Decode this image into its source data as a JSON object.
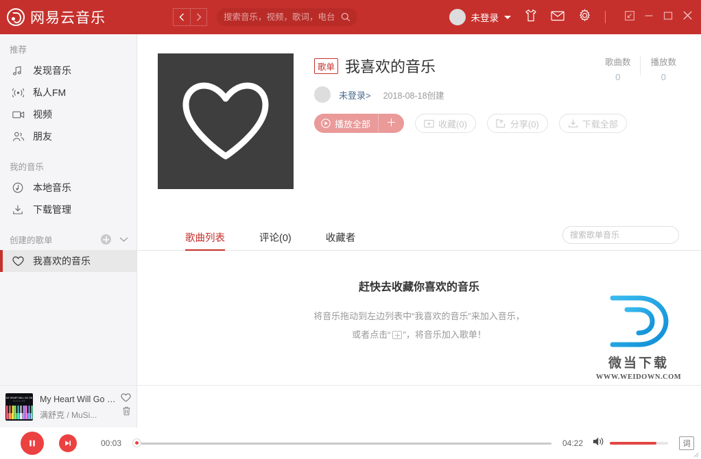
{
  "app": {
    "brand": "网易云音乐",
    "brand_logo_icon": "netease-cloud-music-logo"
  },
  "topbar": {
    "nav_back_icon": "chevron-left-icon",
    "nav_forward_icon": "chevron-right-icon",
    "search": {
      "placeholder": "搜索音乐，视频，歌词，电台",
      "value": "",
      "icon": "search-icon"
    },
    "user": {
      "name": "未登录",
      "avatar_icon": "avatar-placeholder",
      "caret_icon": "chevron-down-icon"
    },
    "icons": {
      "shirt": "shirt-icon",
      "mail": "mail-icon",
      "settings": "gear-icon",
      "mini": "mini-mode-icon",
      "minimize": "minimize-icon",
      "maximize": "maximize-icon",
      "close": "close-icon"
    }
  },
  "sidebar": {
    "sections": [
      {
        "title": "推荐",
        "items": [
          {
            "label": "发现音乐",
            "icon": "music-note-icon",
            "active": false
          },
          {
            "label": "私人FM",
            "icon": "radio-icon",
            "active": false
          },
          {
            "label": "视频",
            "icon": "video-camera-icon",
            "active": false
          },
          {
            "label": "朋友",
            "icon": "friends-icon",
            "active": false
          }
        ]
      },
      {
        "title": "我的音乐",
        "items": [
          {
            "label": "本地音乐",
            "icon": "clock-music-icon",
            "active": false
          },
          {
            "label": "下载管理",
            "icon": "download-icon",
            "active": false
          }
        ]
      },
      {
        "title": "创建的歌单",
        "add_icon": "plus-circle-icon",
        "collapse_icon": "chevron-down-icon",
        "items": [
          {
            "label": "我喜欢的音乐",
            "icon": "heart-outline-icon",
            "active": true
          }
        ]
      }
    ]
  },
  "playlist": {
    "cover_icon": "heart-outline-large-icon",
    "tag": "歌单",
    "title": "我喜欢的音乐",
    "author": "未登录>",
    "author_avatar_icon": "avatar-placeholder",
    "created": "2018-08-18创建",
    "buttons": {
      "play_all": {
        "label": "播放全部",
        "icon": "play-circle-icon"
      },
      "add": {
        "label": "＋",
        "icon": "plus-icon"
      },
      "collect": {
        "label": "收藏(0)",
        "icon": "folder-plus-icon"
      },
      "share": {
        "label": "分享(0)",
        "icon": "share-icon"
      },
      "download": {
        "label": "下载全部",
        "icon": "download-icon"
      }
    },
    "stats": [
      {
        "label": "歌曲数",
        "value": "0"
      },
      {
        "label": "播放数",
        "value": "0"
      }
    ]
  },
  "tabs": {
    "items": [
      {
        "label": "歌曲列表",
        "active": true
      },
      {
        "label": "评论(0)",
        "active": false
      },
      {
        "label": "收藏者",
        "active": false
      }
    ],
    "search": {
      "placeholder": "搜索歌单音乐",
      "value": "",
      "icon": "search-icon"
    }
  },
  "empty_state": {
    "title": "赶快去收藏你喜欢的音乐",
    "line1_before": "将音乐拖动到左边列表中“",
    "line1_highlight": "我喜欢的音乐",
    "line1_after": "”来加入音乐，",
    "line2_before": "或者点击“",
    "line2_icon": "add-to-playlist-icon",
    "line2_after": "”，将音乐加入歌单！"
  },
  "watermark": {
    "logo_icon": "weidown-d-logo",
    "text": "微当下载",
    "url": "WWW.WEIDOWN.COM"
  },
  "now_playing": {
    "album_art_icon": "album-art-piano-keys",
    "title": "My Heart Will Go On",
    "artist": "满舒克 / MuSi...",
    "like_icon": "heart-outline-icon",
    "delete_icon": "trash-icon"
  },
  "player": {
    "pause_icon": "pause-icon",
    "next_icon": "next-track-icon",
    "time_current": "00:03",
    "time_total": "04:22",
    "progress_percent": 1,
    "volume_icon": "volume-icon",
    "volume_percent": 80,
    "lyrics_button_label": "词",
    "resize_grip_icon": "resize-grip-icon"
  },
  "colors": {
    "brand_red": "#c6302c",
    "accent_red": "#ec4141",
    "disabled_red": "#e99a99",
    "sidebar_bg": "#f5f5f7",
    "watermark_blue": "#29a3e0"
  }
}
